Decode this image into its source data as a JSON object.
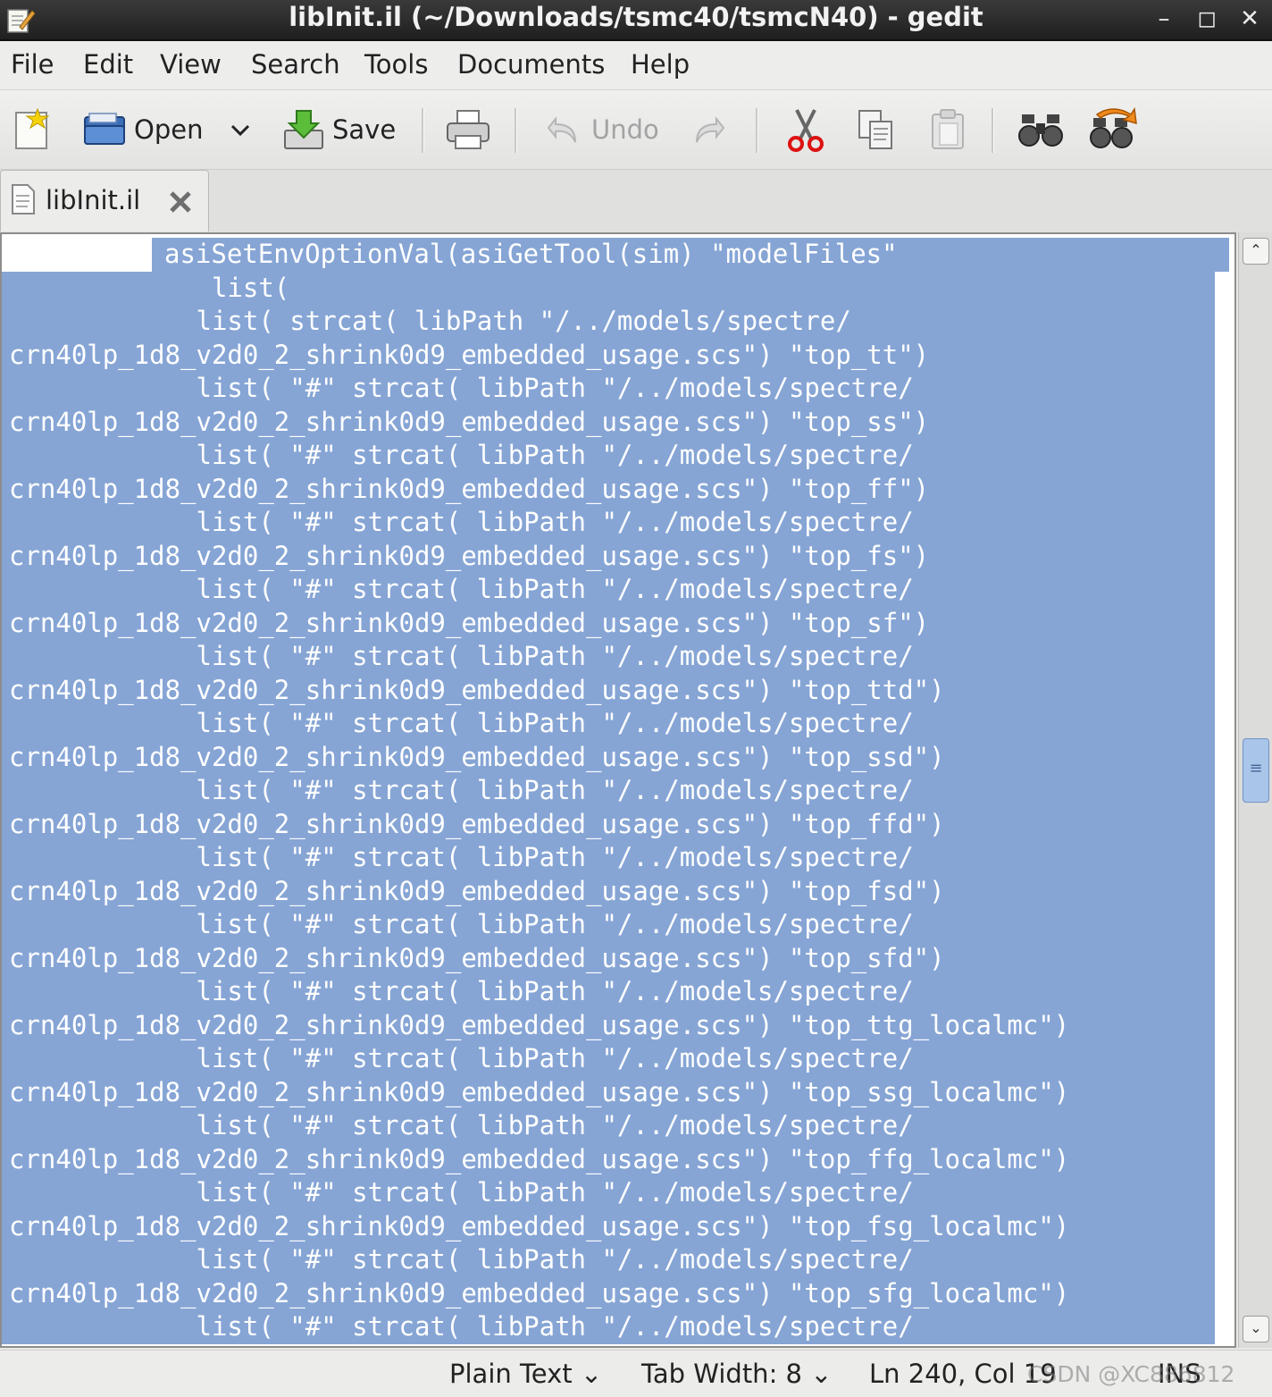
{
  "window": {
    "title": "libInit.il (~/Downloads/tsmc40/tsmcN40) - gedit",
    "min_glyph": "–",
    "max_glyph": "◻",
    "close_glyph": "✕"
  },
  "menu": [
    "File",
    "Edit",
    "View",
    "Search",
    "Tools",
    "Documents",
    "Help"
  ],
  "toolbar": {
    "open_label": "Open",
    "save_label": "Save",
    "undo_label": "Undo",
    "icons": [
      "new-document-icon",
      "open-folder-icon",
      "save-icon",
      "print-icon",
      "undo-icon",
      "redo-icon",
      "cut-icon",
      "copy-icon",
      "paste-icon",
      "find-icon",
      "replace-icon"
    ]
  },
  "tab": {
    "label": "libInit.il"
  },
  "editor": {
    "lines": [
      "asiSetEnvOptionVal(asiGetTool(sim) \"modelFiles\"",
      "             list(",
      "            list( strcat( libPath \"/../models/spectre/",
      "crn40lp_1d8_v2d0_2_shrink0d9_embedded_usage.scs\") \"top_tt\")",
      "            list( \"#\" strcat( libPath \"/../models/spectre/",
      "crn40lp_1d8_v2d0_2_shrink0d9_embedded_usage.scs\") \"top_ss\")",
      "            list( \"#\" strcat( libPath \"/../models/spectre/",
      "crn40lp_1d8_v2d0_2_shrink0d9_embedded_usage.scs\") \"top_ff\")",
      "            list( \"#\" strcat( libPath \"/../models/spectre/",
      "crn40lp_1d8_v2d0_2_shrink0d9_embedded_usage.scs\") \"top_fs\")",
      "            list( \"#\" strcat( libPath \"/../models/spectre/",
      "crn40lp_1d8_v2d0_2_shrink0d9_embedded_usage.scs\") \"top_sf\")",
      "            list( \"#\" strcat( libPath \"/../models/spectre/",
      "crn40lp_1d8_v2d0_2_shrink0d9_embedded_usage.scs\") \"top_ttd\")",
      "            list( \"#\" strcat( libPath \"/../models/spectre/",
      "crn40lp_1d8_v2d0_2_shrink0d9_embedded_usage.scs\") \"top_ssd\")",
      "            list( \"#\" strcat( libPath \"/../models/spectre/",
      "crn40lp_1d8_v2d0_2_shrink0d9_embedded_usage.scs\") \"top_ffd\")",
      "            list( \"#\" strcat( libPath \"/../models/spectre/",
      "crn40lp_1d8_v2d0_2_shrink0d9_embedded_usage.scs\") \"top_fsd\")",
      "            list( \"#\" strcat( libPath \"/../models/spectre/",
      "crn40lp_1d8_v2d0_2_shrink0d9_embedded_usage.scs\") \"top_sfd\")",
      "            list( \"#\" strcat( libPath \"/../models/spectre/",
      "crn40lp_1d8_v2d0_2_shrink0d9_embedded_usage.scs\") \"top_ttg_localmc\")",
      "            list( \"#\" strcat( libPath \"/../models/spectre/",
      "crn40lp_1d8_v2d0_2_shrink0d9_embedded_usage.scs\") \"top_ssg_localmc\")",
      "            list( \"#\" strcat( libPath \"/../models/spectre/",
      "crn40lp_1d8_v2d0_2_shrink0d9_embedded_usage.scs\") \"top_ffg_localmc\")",
      "            list( \"#\" strcat( libPath \"/../models/spectre/",
      "crn40lp_1d8_v2d0_2_shrink0d9_embedded_usage.scs\") \"top_fsg_localmc\")",
      "            list( \"#\" strcat( libPath \"/../models/spectre/",
      "crn40lp_1d8_v2d0_2_shrink0d9_embedded_usage.scs\") \"top_sfg_localmc\")",
      "            list( \"#\" strcat( libPath \"/../models/spectre/"
    ],
    "selection_color": "#86a5d5"
  },
  "scrollbar": {
    "position_fraction": 0.48,
    "grip_glyph": "≡",
    "up_glyph": "⌃",
    "down_glyph": "⌄"
  },
  "status": {
    "language": "Plain Text",
    "tab_width": "Tab Width:  8",
    "cursor": "Ln 240, Col 19",
    "mode": "INS",
    "chevron": "⌄",
    "watermark": "CSDN @XC886812"
  }
}
